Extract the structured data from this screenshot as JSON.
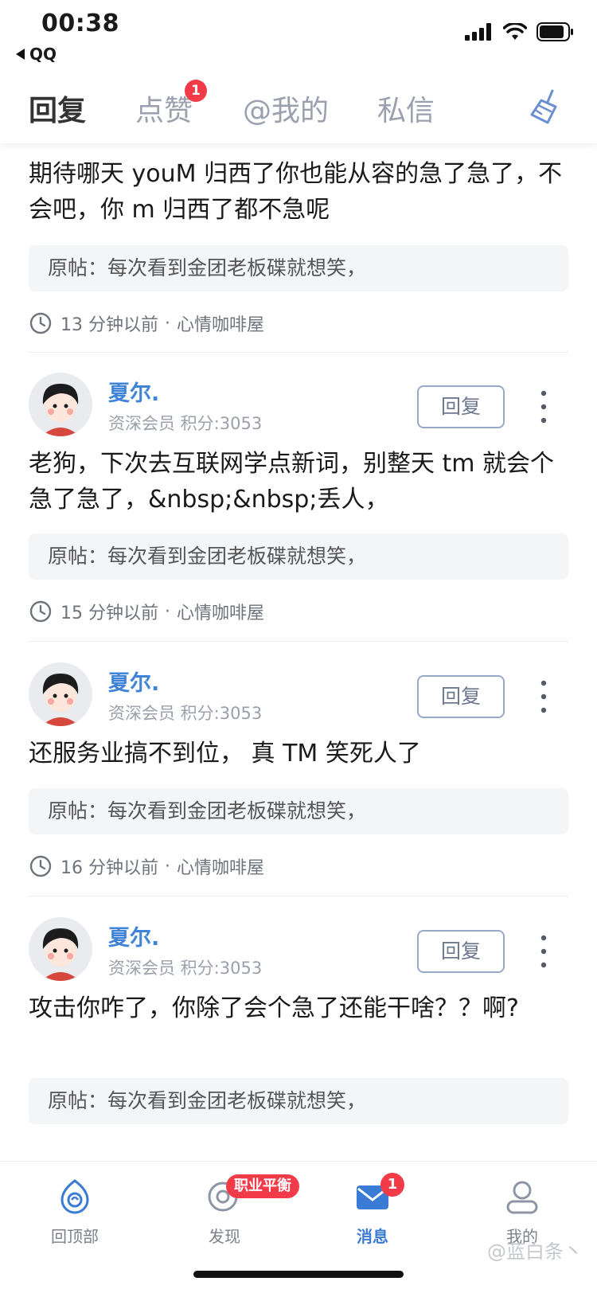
{
  "status_bar": {
    "time": "00:38",
    "back_app": "QQ"
  },
  "tabs": [
    {
      "label": "回复",
      "active": true
    },
    {
      "label": "点赞",
      "badge": "1"
    },
    {
      "label": "@我的"
    },
    {
      "label": "私信"
    }
  ],
  "posts": [
    {
      "text": "期待哪天 youM 归西了你也能从容的急了急了，不会吧，你 m 归西了都不急呢",
      "quote": "原帖：每次看到金团老板碟就想笑，",
      "time_text": "13 分钟以前",
      "board": "心情咖啡屋"
    },
    {
      "username": "夏尔.",
      "member_info": "资深会员 积分:3053",
      "reply_label": "回复",
      "text": "老狗，下次去互联网学点新词，别整天 tm 就会个急了急了，&nbsp;&nbsp;丢人，",
      "quote": "原帖：每次看到金团老板碟就想笑，",
      "time_text": "15 分钟以前",
      "board": "心情咖啡屋"
    },
    {
      "username": "夏尔.",
      "member_info": "资深会员 积分:3053",
      "reply_label": "回复",
      "text": "还服务业搞不到位， 真 TM 笑死人了",
      "quote": "原帖：每次看到金团老板碟就想笑，",
      "time_text": "16 分钟以前",
      "board": "心情咖啡屋"
    },
    {
      "username": "夏尔.",
      "member_info": "资深会员 积分:3053",
      "reply_label": "回复",
      "text": "攻击你咋了，你除了会个急了还能干啥？？啊?",
      "quote": "原帖：每次看到金团老板碟就想笑，"
    }
  ],
  "meta_separator": "·",
  "bottom_nav": [
    {
      "label": "回顶部",
      "icon": "top-icon"
    },
    {
      "label": "发现",
      "icon": "discover-icon",
      "badge": "职业平衡"
    },
    {
      "label": "消息",
      "icon": "message-icon",
      "badge": "1",
      "active": true
    },
    {
      "label": "我的",
      "icon": "profile-icon"
    }
  ],
  "watermark": "@蓝白条丶",
  "colors": {
    "accent": "#3f84d8",
    "badge": "#f23b48",
    "quote_bg": "#f4f5f7"
  }
}
